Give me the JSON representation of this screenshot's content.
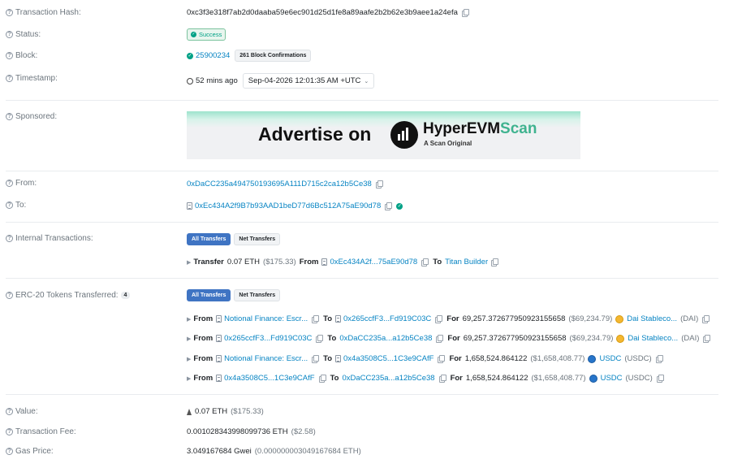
{
  "tx_hash": {
    "label": "Transaction Hash:",
    "value": "0xc3f3e318f7ab2d0daaba59e6ec901d25d1fe8a89aafe2b2b62e3b9aee1a24efa"
  },
  "status": {
    "label": "Status:",
    "value": "Success"
  },
  "block": {
    "label": "Block:",
    "number": "25900234",
    "confirmations": "261 Block Confirmations"
  },
  "timestamp": {
    "label": "Timestamp:",
    "ago": "52 mins ago",
    "date": "Sep-04-2026 12:01:35 AM +UTC"
  },
  "sponsored": {
    "label": "Sponsored:",
    "ad_text": "Advertise on",
    "brand_main": "HyperEVM",
    "brand_accent": "Scan",
    "brand_sub": "A Scan Original"
  },
  "from": {
    "label": "From:",
    "address": "0xDaCC235a494750193695A111D715c2ca12b5Ce38"
  },
  "to": {
    "label": "To:",
    "address": "0xEc434A2f9B7b93AAD1beD77d6Bc512A75aE90d78"
  },
  "internal": {
    "label": "Internal Transactions:",
    "tab_all": "All Transfers",
    "tab_net": "Net Transfers",
    "row": {
      "kw_transfer": "Transfer",
      "amount": "0.07 ETH",
      "usd": "($175.33)",
      "kw_from": "From",
      "from": "0xEc434A2f...75aE90d78",
      "kw_to": "To",
      "to": "Titan Builder"
    }
  },
  "erc20": {
    "label": "ERC-20 Tokens Transferred:",
    "count": "4",
    "tab_all": "All Transfers",
    "tab_net": "Net Transfers",
    "kw_from": "From",
    "kw_to": "To",
    "kw_for": "For",
    "rows": [
      {
        "from": "Notional Finance: Escr...",
        "to": "0x265ccfF3...Fd919C03C",
        "amount": "69,257.372677950923155658",
        "usd": "($69,234.79)",
        "token": "Dai Stableco...",
        "symbol": "(DAI)"
      },
      {
        "from": "0x265ccfF3...Fd919C03C",
        "to": "0xDaCC235a...a12b5Ce38",
        "amount": "69,257.372677950923155658",
        "usd": "($69,234.79)",
        "token": "Dai Stableco...",
        "symbol": "(DAI)"
      },
      {
        "from": "Notional Finance: Escr...",
        "to": "0x4a3508C5...1C3e9CAfF",
        "amount": "1,658,524.864122",
        "usd": "($1,658,408.77)",
        "token": "USDC",
        "symbol": "(USDC)"
      },
      {
        "from": "0x4a3508C5...1C3e9CAfF",
        "to": "0xDaCC235a...a12b5Ce38",
        "amount": "1,658,524.864122",
        "usd": "($1,658,408.77)",
        "token": "USDC",
        "symbol": "(USDC)"
      }
    ]
  },
  "value": {
    "label": "Value:",
    "amount": "0.07 ETH",
    "usd": "($175.33)"
  },
  "fee": {
    "label": "Transaction Fee:",
    "amount": "0.001028343998099736 ETH",
    "usd": "($2.58)"
  },
  "gas": {
    "label": "Gas Price:",
    "amount": "3.049167684 Gwei",
    "eth": "(0.000000003049167684 ETH)"
  }
}
